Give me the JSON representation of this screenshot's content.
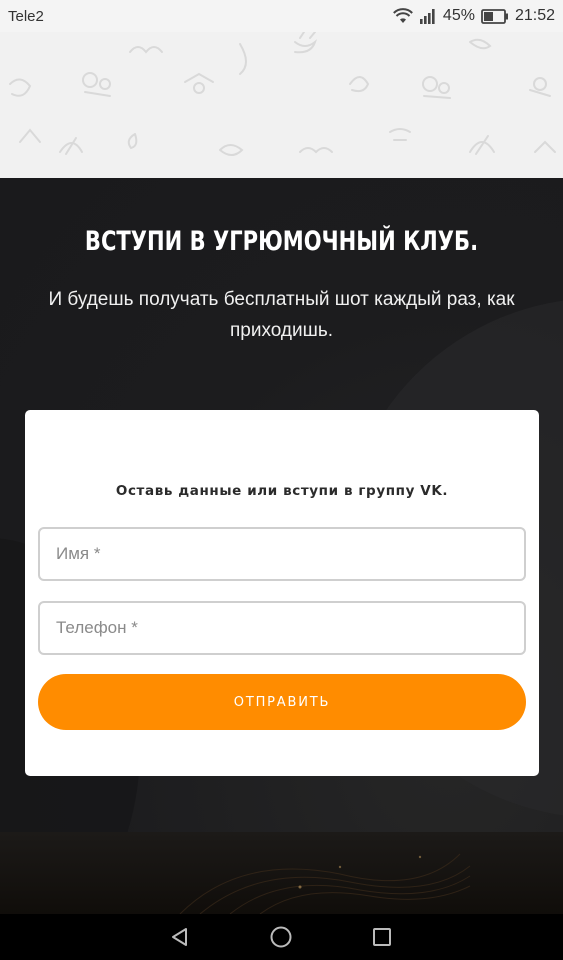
{
  "status_bar": {
    "carrier": "Tele2",
    "battery_percent": "45%",
    "time": "21:52",
    "icons": [
      "wifi-icon",
      "signal-icon",
      "battery-icon"
    ]
  },
  "join_section": {
    "title": "ВСТУПИ В УГРЮМОЧНЫЙ КЛУБ.",
    "subtitle": "И будешь получать бесплатный шот каждый раз, как приходишь."
  },
  "form": {
    "hint": "Оставь данные или вступи в группу VK.",
    "name_placeholder": "Имя *",
    "name_value": "",
    "phone_placeholder": "Телефон *",
    "phone_value": "",
    "submit_label": "ОТПРАВИТЬ"
  },
  "nav_bar": {
    "icons": [
      "back-icon",
      "home-icon",
      "recents-icon"
    ]
  },
  "colors": {
    "accent": "#ff8c00",
    "dark_bg": "#1c1c1e",
    "card_bg": "#ffffff"
  }
}
